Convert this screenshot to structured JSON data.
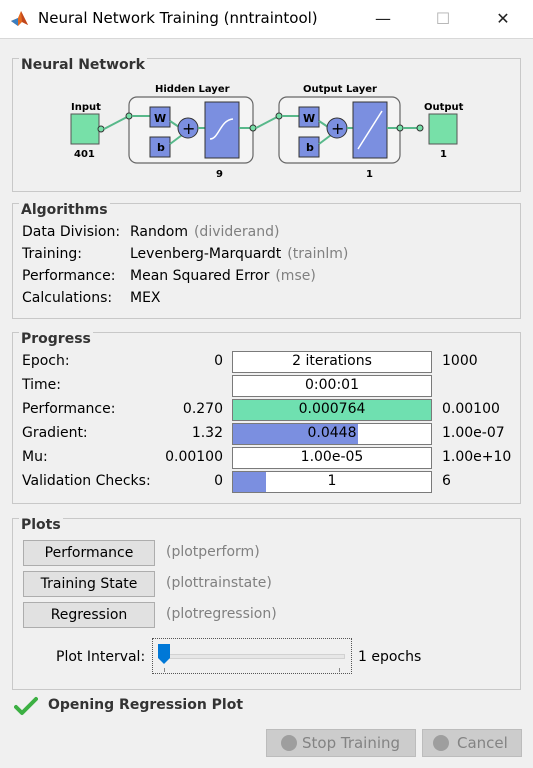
{
  "window": {
    "title": "Neural Network Training (nntraintool)",
    "min": "—",
    "max": "☐",
    "close": "✕"
  },
  "network": {
    "section": "Neural Network",
    "input_label": "Input",
    "input_size": "401",
    "hidden_title": "Hidden Layer",
    "hidden_size": "9",
    "output_title": "Output Layer",
    "output_size": "1",
    "output_label": "Output",
    "output_count": "1",
    "weight": "W",
    "bias": "b",
    "sum": "+"
  },
  "algorithms": {
    "section": "Algorithms",
    "rows": [
      {
        "label": "Data Division:",
        "value": "Random",
        "fn": "(dividerand)"
      },
      {
        "label": "Training:",
        "value": "Levenberg-Marquardt",
        "fn": "(trainlm)"
      },
      {
        "label": "Performance:",
        "value": "Mean Squared Error",
        "fn": "(mse)"
      },
      {
        "label": "Calculations:",
        "value": "MEX",
        "fn": ""
      }
    ]
  },
  "progress": {
    "section": "Progress",
    "rows": [
      {
        "label": "Epoch:",
        "start": "0",
        "current": "2 iterations",
        "end": "1000",
        "fill": 0.0,
        "color": "#7b8fe0"
      },
      {
        "label": "Time:",
        "start": "",
        "current": "0:00:01",
        "end": "",
        "fill": 0.0,
        "color": "#7b8fe0"
      },
      {
        "label": "Performance:",
        "start": "0.270",
        "current": "0.000764",
        "end": "0.00100",
        "fill": 1.0,
        "color": "#6fe0b0"
      },
      {
        "label": "Gradient:",
        "start": "1.32",
        "current": "0.0448",
        "end": "1.00e-07",
        "fill": 0.63,
        "color": "#7b8fe0"
      },
      {
        "label": "Mu:",
        "start": "0.00100",
        "current": "1.00e-05",
        "end": "1.00e+10",
        "fill": 0.0,
        "color": "#7b8fe0"
      },
      {
        "label": "Validation Checks:",
        "start": "0",
        "current": "1",
        "end": "6",
        "fill": 0.167,
        "color": "#7b8fe0"
      }
    ]
  },
  "plots": {
    "section": "Plots",
    "buttons": [
      {
        "label": "Performance",
        "fn": "(plotperform)"
      },
      {
        "label": "Training State",
        "fn": "(plottrainstate)"
      },
      {
        "label": "Regression",
        "fn": "(plotregression)"
      }
    ],
    "interval_label": "Plot Interval:",
    "interval_value": "1 epochs",
    "interval_fraction": 0.0
  },
  "status": {
    "text": "Opening Regression Plot",
    "icon": "check-icon",
    "color": "#3cb043"
  },
  "actions": {
    "stop": "Stop Training",
    "cancel": "Cancel"
  }
}
